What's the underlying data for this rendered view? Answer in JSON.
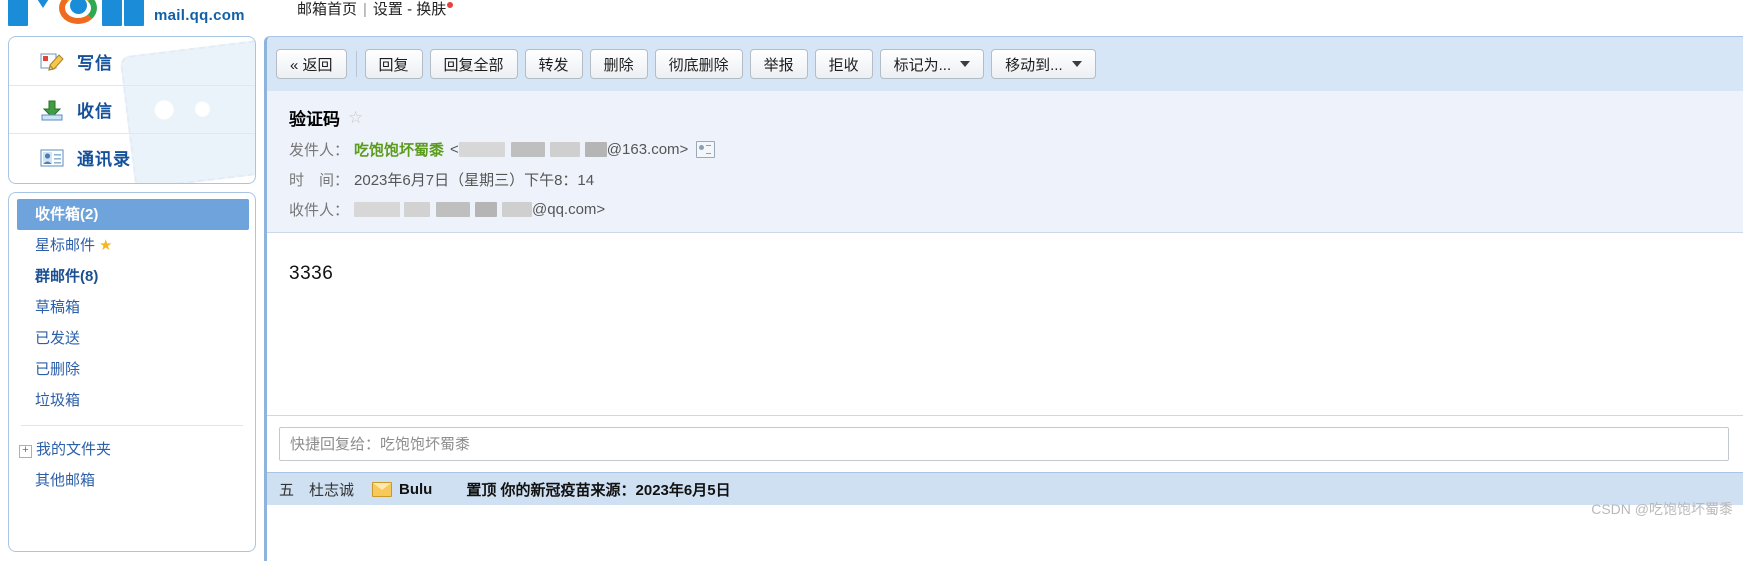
{
  "header": {
    "logo_text": "mail.qq.com",
    "nav": {
      "home": "邮箱首页",
      "separator": "|",
      "settings": "设置",
      "dash": "-",
      "skin": "换肤"
    }
  },
  "sidebar": {
    "actions": [
      {
        "label": "写信",
        "icon": "compose-icon"
      },
      {
        "label": "收信",
        "icon": "receive-icon"
      },
      {
        "label": "通讯录",
        "icon": "contacts-icon"
      }
    ],
    "folders": [
      {
        "label": "收件箱(2)",
        "selected": true,
        "bold": true
      },
      {
        "label": "星标邮件",
        "star": "★",
        "selected": false,
        "bold": false
      },
      {
        "label": "群邮件(8)",
        "selected": false,
        "bold": true
      },
      {
        "label": "草稿箱",
        "selected": false,
        "bold": false
      },
      {
        "label": "已发送",
        "selected": false,
        "bold": false
      },
      {
        "label": "已删除",
        "selected": false,
        "bold": false
      },
      {
        "label": "垃圾箱",
        "selected": false,
        "bold": false
      }
    ],
    "my_folder": "我的文件夹",
    "other_mailbox": "其他邮箱",
    "expander_glyph": "+"
  },
  "toolbar": {
    "back": "« 返回",
    "reply": "回复",
    "reply_all": "回复全部",
    "forward": "转发",
    "delete": "删除",
    "delete_forever": "彻底删除",
    "report": "举报",
    "reject": "拒收",
    "mark_as": "标记为...",
    "move_to": "移动到..."
  },
  "mail": {
    "subject": "验证码",
    "star_glyph": "☆",
    "from_label": "发件人：",
    "from_name": "吃饱饱坏蜀黍",
    "from_address_open": "<",
    "from_domain": "@163.com>",
    "time_label": "时　间：",
    "time_value": "2023年6月7日（星期三）下午8：14",
    "to_label": "收件人：",
    "to_domain": "@qq.com>",
    "body": "3336"
  },
  "quick_reply": {
    "placeholder": "快捷回复给：吃饱饱坏蜀黍",
    "value": ""
  },
  "next_mail": {
    "date": "五　杜志诚",
    "from": "Bulu",
    "subject": "置顶  你的新冠疫苗来源：2023年6月5日"
  },
  "watermark": "CSDN @吃饱饱坏蜀黍",
  "colors": {
    "accent_blue": "#1a8cd8",
    "selected_folder": "#6fa3db",
    "toolbar_bg": "#d7e6f6",
    "sender_green": "#5b9b1e",
    "star_gold": "#f5b622"
  }
}
